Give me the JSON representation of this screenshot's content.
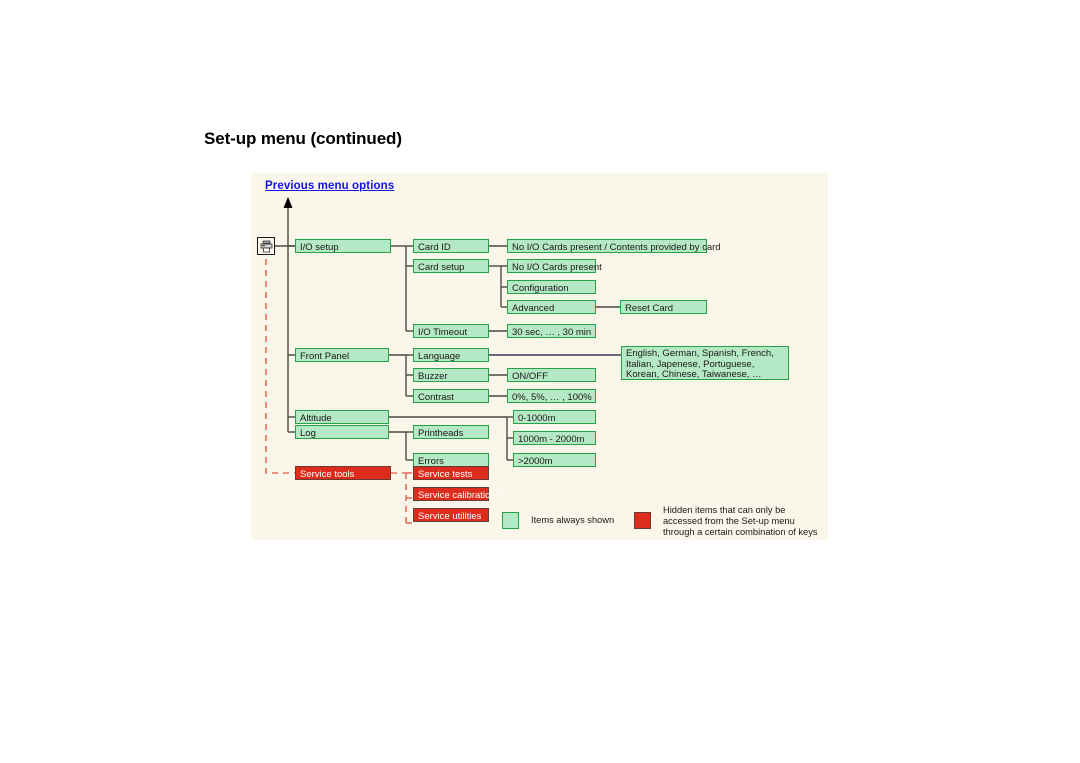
{
  "page": {
    "title": "Set-up menu (continued)",
    "background": "#ffffff",
    "panel_background": "#faf6e9"
  },
  "diagram": {
    "previous_link": "Previous menu options",
    "root_icon": "printer-icon",
    "colors": {
      "green_fill": "#b5e8c4",
      "green_border": "#25a249",
      "red_fill": "#dd2b1c",
      "red_border": "#6b3a32",
      "dashed_line": "#e8705f",
      "solid_line": "#4a4a42",
      "link": "#1414e6"
    },
    "nodes": {
      "io_setup": "I/O setup",
      "card_id": "Card ID",
      "card_id_value": "No I/O Cards present / Contents provided by card",
      "card_setup": "Card setup",
      "card_setup_1": "No I/O Cards present",
      "card_setup_2": "Configuration",
      "card_setup_3": "Advanced",
      "reset_card": "Reset Card",
      "io_timeout": "I/O Timeout",
      "io_timeout_value": "30 sec, … , 30 min",
      "front_panel": "Front Panel",
      "language": "Language",
      "language_value": "English, German, Spanish, French, Italian, Japenese, Portuguese,  Korean, Chinese, Taiwanese, …",
      "buzzer": "Buzzer",
      "buzzer_value": "ON/OFF",
      "contrast": "Contrast",
      "contrast_value": "0%, 5%, … , 100%",
      "altitude": "Altitude",
      "altitude_1": "0-1000m",
      "altitude_2": "1000m - 2000m",
      "altitude_3": ">2000m",
      "log": "Log",
      "log_1": "Printheads",
      "log_2": "Errors",
      "service_tools": "Service tools",
      "service_1": "Service tests",
      "service_2": "Service calibrations",
      "service_3": "Service utilities"
    }
  },
  "legend": {
    "always_shown": "Items always shown",
    "hidden_items": "Hidden items that can only be accessed from the Set-up menu through a certain combination of keys"
  }
}
